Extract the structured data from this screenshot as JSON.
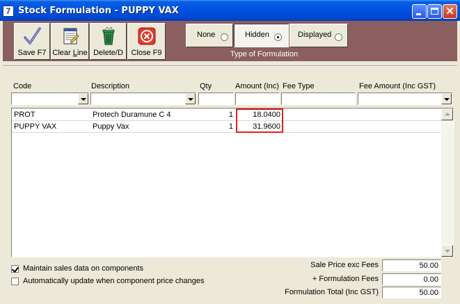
{
  "window": {
    "icon_glyph": "7",
    "title": "Stock Formulation - PUPPY VAX",
    "close_glyph": "✕"
  },
  "toolbar": {
    "save_label": "Save F7",
    "clear_line_prefix": "Clear ",
    "clear_line_underlined": "L",
    "clear_line_suffix": "ine",
    "delete_label": "Delete/D",
    "close_label": "Close F9"
  },
  "formulation_type": {
    "caption": "Type of Formulation",
    "options": [
      {
        "label": "None",
        "selected": false
      },
      {
        "label": "Hidden",
        "selected": true
      },
      {
        "label": "Displayed",
        "selected": false
      }
    ]
  },
  "columns": {
    "code": "Code",
    "description": "Description",
    "qty": "Qty",
    "amount": "Amount (Inc)",
    "fee_type": "Fee Type",
    "fee_amount": "Fee Amount (Inc GST)"
  },
  "rows": [
    {
      "code": "PROT",
      "description": "Protech Duramune C 4",
      "qty": "1",
      "amount": "18.0400"
    },
    {
      "code": "PUPPY VAX",
      "description": "Puppy Vax",
      "qty": "1",
      "amount": "31.9600"
    }
  ],
  "options": {
    "maintain_sales_label": "Maintain sales data on components",
    "maintain_sales_checked": true,
    "auto_update_label": "Automatically update when component price changes",
    "auto_update_checked": false
  },
  "totals": {
    "sale_price_label": "Sale Price exc Fees",
    "sale_price_value": "50.00",
    "formulation_fees_label": "+ Formulation Fees",
    "formulation_fees_value": "0.00",
    "total_label": "Formulation Total (Inc GST)",
    "total_value": "50.00"
  },
  "colors": {
    "toolbar_band": "#8b5f5f",
    "highlight_box": "#e02020",
    "titlebar": "#0054e3"
  }
}
